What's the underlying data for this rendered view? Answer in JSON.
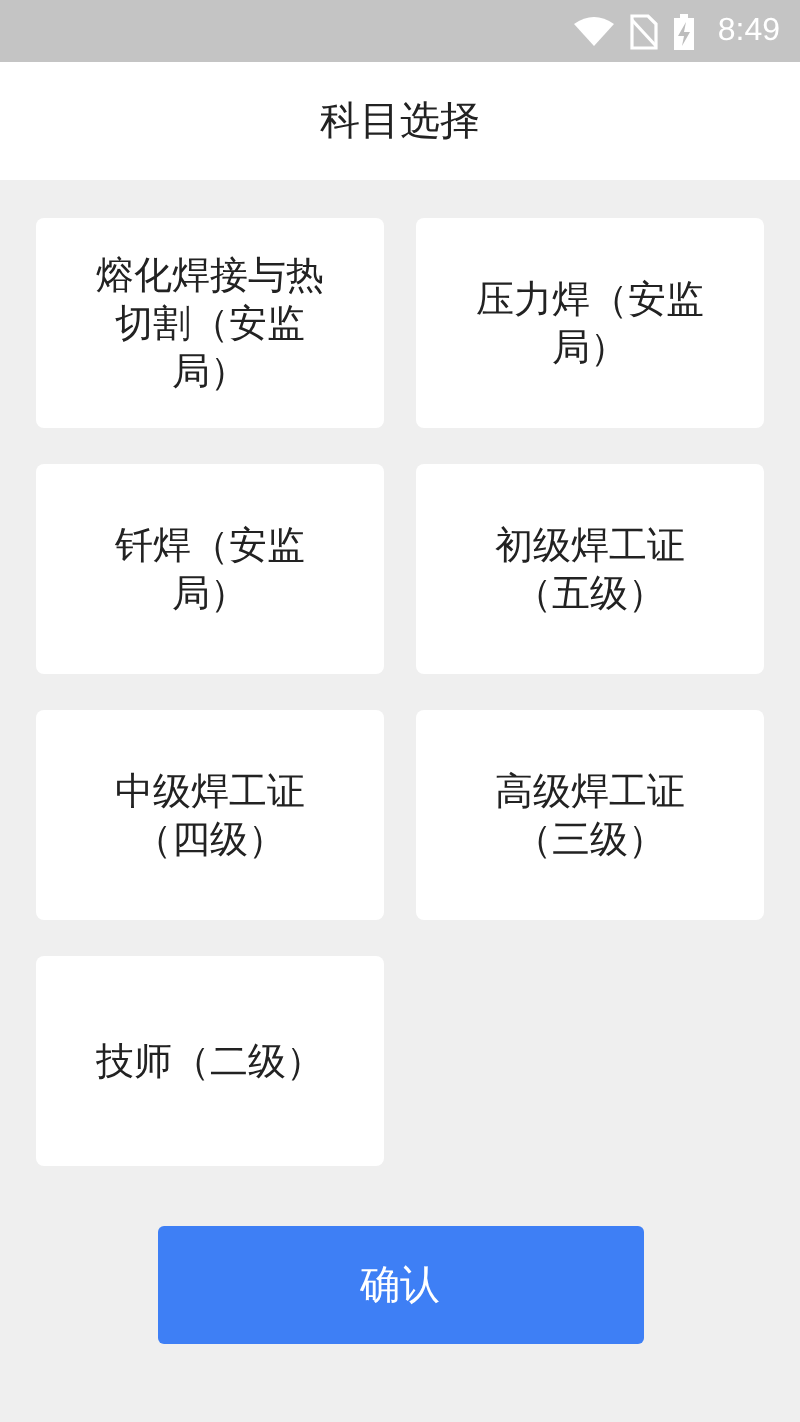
{
  "status_bar": {
    "time": "8:49"
  },
  "header": {
    "title": "科目选择"
  },
  "subjects": [
    {
      "label": "熔化焊接与热切割（安监局）"
    },
    {
      "label": "压力焊（安监局）"
    },
    {
      "label": "钎焊（安监局）"
    },
    {
      "label": "初级焊工证（五级）"
    },
    {
      "label": "中级焊工证（四级）"
    },
    {
      "label": "高级焊工证（三级）"
    },
    {
      "label": "技师（二级）"
    }
  ],
  "confirm_button": {
    "label": "确认"
  }
}
